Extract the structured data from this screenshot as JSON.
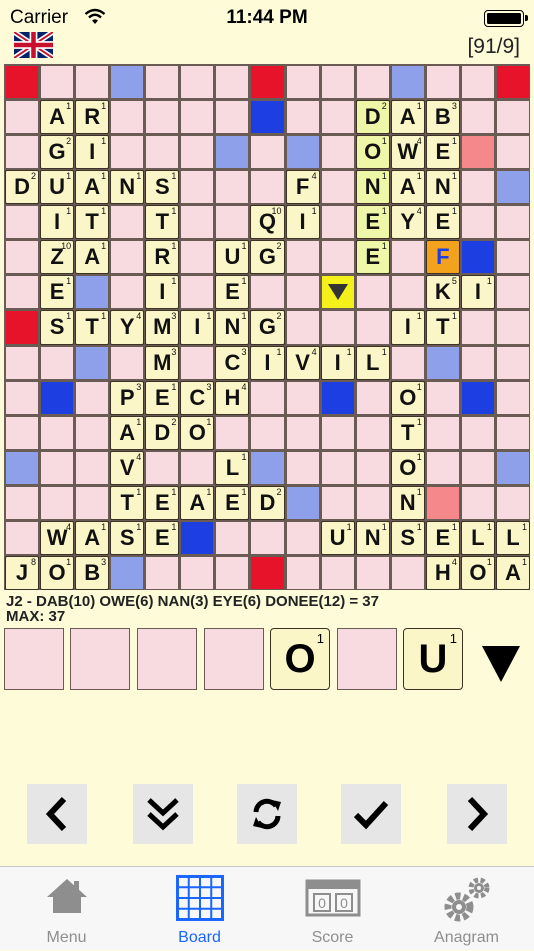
{
  "status": {
    "carrier": "Carrier",
    "time": "11:44 PM"
  },
  "header": {
    "counter": "[91/9]",
    "flag_icon": "uk-flag-icon"
  },
  "board": {
    "rows": [
      "...............",
      ".AR.......DAB..",
      ".GI.......OWE..",
      "DUANS...F.NAN..",
      ".IT.T..QI.EYE..",
      ".ZA.R.UG..E.f..",
      ".E..I.E.....KI.",
      ".STYMING...IT..",
      "....M.CIVIL....",
      "...PECH....O...",
      "...ADO.....T...",
      "...V..L....O...",
      "...TEAED...N...",
      ".WASE....UNSELL",
      "JOB.........HOAX"
    ],
    "premium": [
      "T..D...T...D..T",
      ".......L.......",
      "......D.D....W.",
      "..............D",
      "...............",
      "......L......L.",
      "..D.........D..",
      "T..............",
      "..D.........D..",
      ".L.......L...L.",
      "...............",
      "D......D...W..D",
      "........D...W..",
      ".....L.........",
      "...D...T.......",
      "..............."
    ]
  },
  "move": {
    "line1": "J2 - DAB(10) OWE(6) NAN(3) EYE(6) DONEE(12)  = 37",
    "line2": "MAX: 37"
  },
  "rack": {
    "slots": [
      {
        "letter": "",
        "points": ""
      },
      {
        "letter": "",
        "points": ""
      },
      {
        "letter": "",
        "points": ""
      },
      {
        "letter": "",
        "points": ""
      },
      {
        "letter": "O",
        "points": "1"
      },
      {
        "letter": "",
        "points": ""
      },
      {
        "letter": "U",
        "points": "1"
      }
    ]
  },
  "controls": {
    "prev": "chevron-left-icon",
    "down": "double-chevron-down-icon",
    "refresh": "refresh-icon",
    "confirm": "checkmark-icon",
    "next": "chevron-right-icon"
  },
  "tabs": [
    {
      "label": "Menu",
      "icon": "home-icon"
    },
    {
      "label": "Board",
      "icon": "grid-icon"
    },
    {
      "label": "Score",
      "icon": "scoreboard-icon"
    },
    {
      "label": "Anagram",
      "icon": "gears-icon"
    }
  ],
  "colors": {
    "accent": "#1a66ff",
    "background": "#fefbd8",
    "highlight": "#e9f7a2",
    "cursor": "#f4f11a"
  }
}
